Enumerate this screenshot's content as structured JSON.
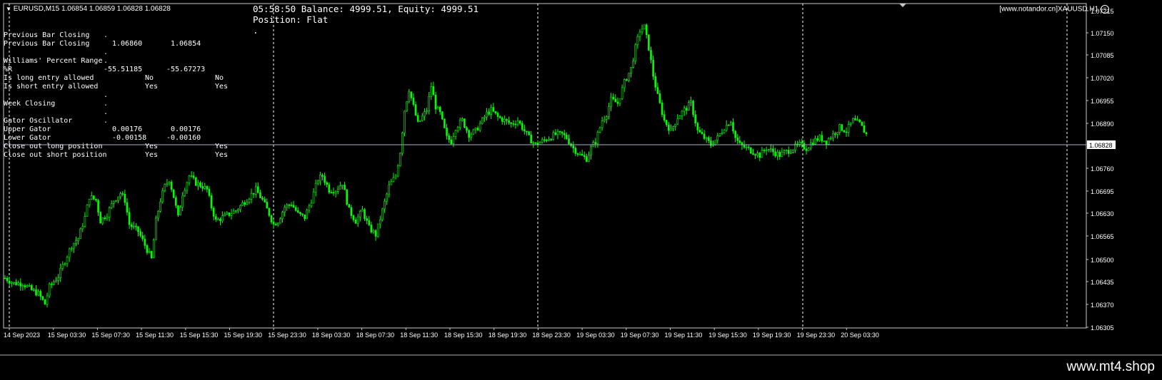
{
  "symbol_bar": {
    "expand_icon": "triangle-down-icon",
    "text": "EURUSD,M15  1.06854 1.06859 1.06828 1.06828"
  },
  "status": {
    "line1": "05:58:50 Balance: 4999.51, Equity: 4999.51",
    "line2": "Position: Flat",
    "line3": "."
  },
  "brand_box": "[www.notandor.cn]XAUUSD H1",
  "brand_icon": "smiley-icon",
  "info_panel": [
    {
      "label": "Previous Bar Closing",
      "v1": ".",
      "v2": ""
    },
    {
      "label": "Previous Bar Closing",
      "v1": "1.06860",
      "v2": "1.06854"
    },
    {
      "label": "",
      "v1": ".",
      "v2": ""
    },
    {
      "label": "Williams' Percent Range",
      "v1": ".",
      "v2": ""
    },
    {
      "label": "%R",
      "v1": "-55.51185",
      "v2": "-55.67273"
    },
    {
      "label": "Is long entry allowed",
      "v1": "No",
      "v2": "No"
    },
    {
      "label": "Is short entry allowed",
      "v1": "Yes",
      "v2": "Yes"
    },
    {
      "label": "",
      "v1": ".",
      "v2": ""
    },
    {
      "label": "Week Closing",
      "v1": ".",
      "v2": ""
    },
    {
      "label": "",
      "v1": ".",
      "v2": ""
    },
    {
      "label": "Gator Oscillator",
      "v1": ".",
      "v2": ""
    },
    {
      "label": "Upper Gator",
      "v1": "0.00176",
      "v2": "0.00176"
    },
    {
      "label": "Lower Gator",
      "v1": "-0.00158",
      "v2": "-0.00160"
    },
    {
      "label": "Close out long position",
      "v1": "Yes",
      "v2": "Yes"
    },
    {
      "label": "Close out short position",
      "v1": "Yes",
      "v2": "Yes"
    }
  ],
  "colors": {
    "background": "#000000",
    "candle": "#00ff00",
    "grid": "#ffffff",
    "price_line": "#a8b4c8",
    "axis_text": "#ffffff"
  },
  "chart_data": {
    "type": "candlestick",
    "symbol": "EURUSD",
    "timeframe": "M15",
    "current_price": "1.06828",
    "y_ticks": [
      "1.07215",
      "1.07150",
      "1.07085",
      "1.07020",
      "1.06955",
      "1.06890",
      "1.06828",
      "1.06760",
      "1.06695",
      "1.06630",
      "1.06565",
      "1.06500",
      "1.06435",
      "1.06370",
      "1.06305"
    ],
    "x_ticks": [
      "14 Sep 2023",
      "15 Sep 03:30",
      "15 Sep 07:30",
      "15 Sep 11:30",
      "15 Sep 15:30",
      "15 Sep 19:30",
      "15 Sep 23:30",
      "18 Sep 03:30",
      "18 Sep 07:30",
      "18 Sep 11:30",
      "18 Sep 15:30",
      "18 Sep 19:30",
      "18 Sep 23:30",
      "19 Sep 03:30",
      "19 Sep 07:30",
      "19 Sep 11:30",
      "19 Sep 15:30",
      "19 Sep 19:30",
      "19 Sep 23:30",
      "20 Sep 03:30"
    ],
    "price_range": [
      1.06305,
      1.07215
    ],
    "session_separators": [
      "14 Sep 2023",
      "15 Sep 23:30",
      "18 Sep 23:30",
      "19 Sep 23:30"
    ],
    "path_points": [
      [
        0,
        1.06445
      ],
      [
        4,
        1.0643
      ],
      [
        8,
        1.0643
      ],
      [
        12,
        1.0641
      ],
      [
        15,
        1.064
      ],
      [
        18,
        1.0637
      ],
      [
        20,
        1.0642
      ],
      [
        24,
        1.0645
      ],
      [
        28,
        1.0651
      ],
      [
        30,
        1.0654
      ],
      [
        33,
        1.0656
      ],
      [
        36,
        1.0662
      ],
      [
        38,
        1.0668
      ],
      [
        41,
        1.0667
      ],
      [
        43,
        1.0661
      ],
      [
        46,
        1.0663
      ],
      [
        49,
        1.0667
      ],
      [
        52,
        1.0669
      ],
      [
        54,
        1.0667
      ],
      [
        56,
        1.066
      ],
      [
        60,
        1.0658
      ],
      [
        63,
        1.0654
      ],
      [
        66,
        1.065
      ],
      [
        68,
        1.0661
      ],
      [
        70,
        1.0667
      ],
      [
        72,
        1.0671
      ],
      [
        74,
        1.0673
      ],
      [
        76,
        1.0668
      ],
      [
        78,
        1.0662
      ],
      [
        80,
        1.0669
      ],
      [
        83,
        1.0674
      ],
      [
        86,
        1.0672
      ],
      [
        89,
        1.0671
      ],
      [
        91,
        1.067
      ],
      [
        93,
        1.0665
      ],
      [
        95,
        1.0661
      ],
      [
        98,
        1.0662
      ],
      [
        101,
        1.0663
      ],
      [
        104,
        1.0664
      ],
      [
        107,
        1.0666
      ],
      [
        110,
        1.0668
      ],
      [
        113,
        1.067
      ],
      [
        116,
        1.0667
      ],
      [
        119,
        1.0663
      ],
      [
        121,
        1.066
      ],
      [
        123,
        1.0661
      ],
      [
        126,
        1.0665
      ],
      [
        129,
        1.0666
      ],
      [
        132,
        1.0663
      ],
      [
        135,
        1.0662
      ],
      [
        138,
        1.0667
      ],
      [
        141,
        1.0673
      ],
      [
        143,
        1.0674
      ],
      [
        146,
        1.067
      ],
      [
        149,
        1.067
      ],
      [
        152,
        1.0672
      ],
      [
        155,
        1.0664
      ],
      [
        158,
        1.0661
      ],
      [
        161,
        1.0664
      ],
      [
        164,
        1.0659
      ],
      [
        167,
        1.0657
      ],
      [
        170,
        1.0664
      ],
      [
        173,
        1.0671
      ],
      [
        176,
        1.0674
      ],
      [
        178,
        1.0681
      ],
      [
        180,
        1.0693
      ],
      [
        182,
        1.0699
      ],
      [
        184,
        1.0694
      ],
      [
        186,
        1.0689
      ],
      [
        188,
        1.0691
      ],
      [
        190,
        1.0693
      ],
      [
        192,
        1.07
      ],
      [
        194,
        1.0694
      ],
      [
        196,
        1.0692
      ],
      [
        199,
        1.0685
      ],
      [
        201,
        1.0684
      ],
      [
        203,
        1.0688
      ],
      [
        206,
        1.069
      ],
      [
        209,
        1.0686
      ],
      [
        212,
        1.0687
      ],
      [
        215,
        1.069
      ],
      [
        217,
        1.0692
      ],
      [
        219,
        1.0693
      ],
      [
        222,
        1.0691
      ],
      [
        225,
        1.069
      ],
      [
        228,
        1.0689
      ],
      [
        231,
        1.069
      ],
      [
        233,
        1.0688
      ],
      [
        236,
        1.0685
      ],
      [
        239,
        1.0683
      ],
      [
        242,
        1.0684
      ],
      [
        245,
        1.0685
      ],
      [
        248,
        1.0686
      ],
      [
        251,
        1.0686
      ],
      [
        253,
        1.0685
      ],
      [
        256,
        1.0682
      ],
      [
        259,
        1.068
      ],
      [
        262,
        1.0679
      ],
      [
        264,
        1.0682
      ],
      [
        266,
        1.0684
      ],
      [
        269,
        1.069
      ],
      [
        271,
        1.0692
      ],
      [
        273,
        1.0696
      ],
      [
        276,
        1.0695
      ],
      [
        279,
        1.0701
      ],
      [
        282,
        1.0705
      ],
      [
        284,
        1.0711
      ],
      [
        286,
        1.0716
      ],
      [
        288,
        1.0717
      ],
      [
        290,
        1.0711
      ],
      [
        292,
        1.0703
      ],
      [
        294,
        1.0697
      ],
      [
        297,
        1.069
      ],
      [
        300,
        1.0687
      ],
      [
        303,
        1.0691
      ],
      [
        306,
        1.0693
      ],
      [
        309,
        1.0695
      ],
      [
        312,
        1.0687
      ],
      [
        315,
        1.0685
      ],
      [
        318,
        1.0683
      ],
      [
        321,
        1.0685
      ],
      [
        324,
        1.0688
      ],
      [
        327,
        1.069
      ],
      [
        329,
        1.0685
      ],
      [
        331,
        1.0683
      ],
      [
        334,
        1.0682
      ],
      [
        337,
        1.0681
      ],
      [
        340,
        1.068
      ],
      [
        343,
        1.0682
      ],
      [
        346,
        1.0681
      ],
      [
        349,
        1.068
      ],
      [
        352,
        1.0681
      ],
      [
        355,
        1.0682
      ],
      [
        358,
        1.0683
      ],
      [
        361,
        1.0682
      ],
      [
        364,
        1.0684
      ],
      [
        367,
        1.0685
      ],
      [
        370,
        1.0684
      ],
      [
        373,
        1.0686
      ],
      [
        376,
        1.0688
      ],
      [
        379,
        1.0687
      ],
      [
        382,
        1.069
      ],
      [
        385,
        1.0689
      ],
      [
        388,
        1.0686
      ]
    ]
  },
  "footer": {
    "site": "www.mt4.shop"
  }
}
